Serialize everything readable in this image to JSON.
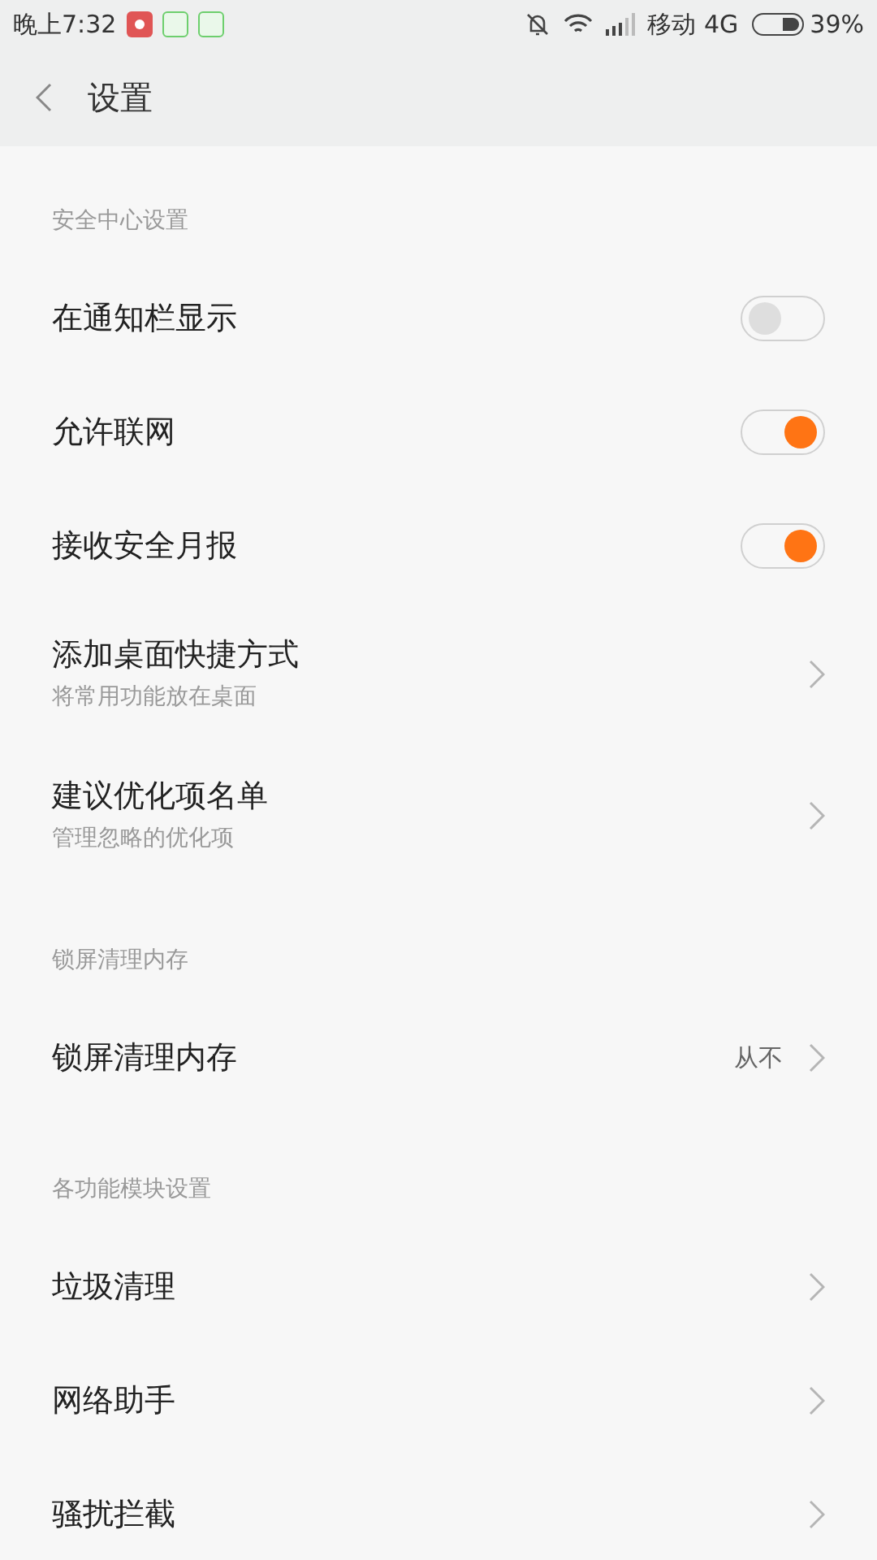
{
  "status_bar": {
    "time": "晚上7:32",
    "carrier": "移动 4G",
    "battery": "39%"
  },
  "header": {
    "title": "设置"
  },
  "sections": [
    {
      "title": "安全中心设置",
      "items": [
        {
          "kind": "toggle",
          "label": "在通知栏显示",
          "on": false
        },
        {
          "kind": "toggle",
          "label": "允许联网",
          "on": true
        },
        {
          "kind": "toggle",
          "label": "接收安全月报",
          "on": true
        },
        {
          "kind": "link",
          "label": "添加桌面快捷方式",
          "subtitle": "将常用功能放在桌面"
        },
        {
          "kind": "link",
          "label": "建议优化项名单",
          "subtitle": "管理忽略的优化项"
        }
      ]
    },
    {
      "title": "锁屏清理内存",
      "items": [
        {
          "kind": "link",
          "label": "锁屏清理内存",
          "value": "从不"
        }
      ]
    },
    {
      "title": "各功能模块设置",
      "items": [
        {
          "kind": "link",
          "label": "垃圾清理"
        },
        {
          "kind": "link",
          "label": "网络助手"
        },
        {
          "kind": "link",
          "label": "骚扰拦截"
        }
      ]
    }
  ]
}
